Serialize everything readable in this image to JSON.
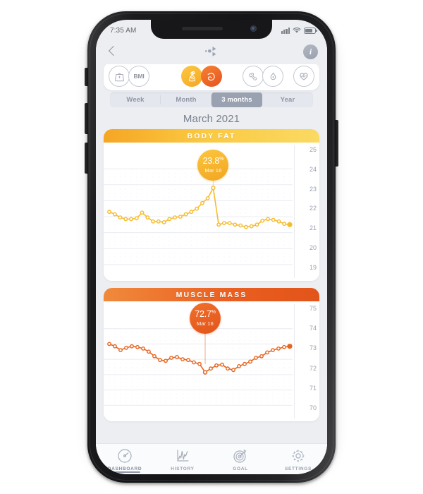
{
  "status_bar": {
    "time": "7:35 AM",
    "signal_icon": "cellular-bars-icon",
    "wifi_icon": "wifi-icon",
    "battery_icon": "battery-icon"
  },
  "header": {
    "back_icon": "back-chevron-icon",
    "logo_icon": "app-logo-icon",
    "info_label": "i"
  },
  "metrics": [
    {
      "id": "weight",
      "icon": "weight-scale-icon",
      "label": "",
      "active": false
    },
    {
      "id": "bmi",
      "icon": "bmi-icon",
      "label": "BMI",
      "active": false
    },
    {
      "id": "body-fat",
      "icon": "body-fat-icon",
      "label": "",
      "active": true
    },
    {
      "id": "muscle",
      "icon": "muscle-arm-icon",
      "label": "",
      "active": true
    },
    {
      "id": "bone",
      "icon": "bone-icon",
      "label": "",
      "active": false
    },
    {
      "id": "water",
      "icon": "water-drop-icon",
      "label": "",
      "active": false
    },
    {
      "id": "heart",
      "icon": "heart-pulse-icon",
      "label": "",
      "active": false
    }
  ],
  "period_tabs": [
    {
      "label": "Week",
      "selected": false
    },
    {
      "label": "Month",
      "selected": false
    },
    {
      "label": "3 months",
      "selected": true
    },
    {
      "label": "Year",
      "selected": false
    }
  ],
  "month_title": "March 2021",
  "charts": [
    {
      "title": "BODY FAT",
      "bubble": {
        "value": "23.8",
        "unit": "%",
        "date": "Mar 16"
      },
      "accent": "#f5a623"
    },
    {
      "title": "MUSCLE MASS",
      "bubble": {
        "value": "72.7",
        "unit": "%",
        "date": "Mar 16"
      },
      "accent": "#e8521d"
    }
  ],
  "bottom_nav": [
    {
      "label": "DASHBOARD",
      "icon": "gauge-icon",
      "active": true
    },
    {
      "label": "HISTORY",
      "icon": "chart-icon",
      "active": false
    },
    {
      "label": "GOAL",
      "icon": "target-icon",
      "active": false
    },
    {
      "label": "SETTINGS",
      "icon": "gear-icon",
      "active": false
    }
  ],
  "chart_data": [
    {
      "type": "line",
      "title": "BODY FAT",
      "ylabel": "",
      "xlabel": "",
      "ylim": [
        18.6,
        25.4
      ],
      "yticks": [
        "25",
        "24",
        "23",
        "22",
        "21",
        "20",
        "19"
      ],
      "grid": true,
      "legend": "none",
      "unit": "%",
      "color": "#f7bb2e",
      "highlight": {
        "index": 19,
        "value": 23.8,
        "label": "Mar 16"
      },
      "x": [
        "1",
        "2",
        "3",
        "4",
        "5",
        "6",
        "7",
        "8",
        "9",
        "10",
        "11",
        "12",
        "13",
        "14",
        "15",
        "16",
        "17",
        "18",
        "19",
        "20",
        "21",
        "22",
        "23",
        "24",
        "25",
        "26",
        "27",
        "28",
        "29",
        "30",
        "31",
        "32",
        "33",
        "34"
      ],
      "values": [
        22.3,
        22.15,
        21.95,
        21.85,
        21.85,
        21.9,
        22.25,
        21.95,
        21.7,
        21.7,
        21.65,
        21.85,
        21.95,
        22.0,
        22.15,
        22.3,
        22.5,
        22.85,
        23.15,
        23.8,
        21.5,
        21.6,
        21.6,
        21.5,
        21.45,
        21.35,
        21.4,
        21.5,
        21.75,
        21.85,
        21.8,
        21.7,
        21.55,
        21.5
      ]
    },
    {
      "type": "line",
      "title": "MUSCLE MASS",
      "ylabel": "",
      "xlabel": "",
      "ylim": [
        69.6,
        75.4
      ],
      "yticks": [
        "75",
        "74",
        "73",
        "72",
        "71",
        "70"
      ],
      "grid": true,
      "legend": "none",
      "unit": "%",
      "color": "#e8651f",
      "highlight": {
        "index": 17,
        "value": 72.7,
        "label": "Mar 16"
      },
      "x": [
        "1",
        "2",
        "3",
        "4",
        "5",
        "6",
        "7",
        "8",
        "9",
        "10",
        "11",
        "12",
        "13",
        "14",
        "15",
        "16",
        "17",
        "18",
        "19",
        "20",
        "21",
        "22",
        "23",
        "24",
        "25",
        "26",
        "27",
        "28",
        "29",
        "30",
        "31",
        "32",
        "33"
      ],
      "values": [
        74.0,
        73.85,
        73.6,
        73.75,
        73.85,
        73.8,
        73.7,
        73.5,
        73.2,
        72.95,
        72.9,
        73.1,
        73.15,
        73.0,
        72.95,
        72.8,
        72.7,
        72.15,
        72.4,
        72.6,
        72.65,
        72.4,
        72.3,
        72.55,
        72.7,
        72.85,
        73.1,
        73.2,
        73.45,
        73.6,
        73.7,
        73.8,
        73.85
      ]
    }
  ]
}
